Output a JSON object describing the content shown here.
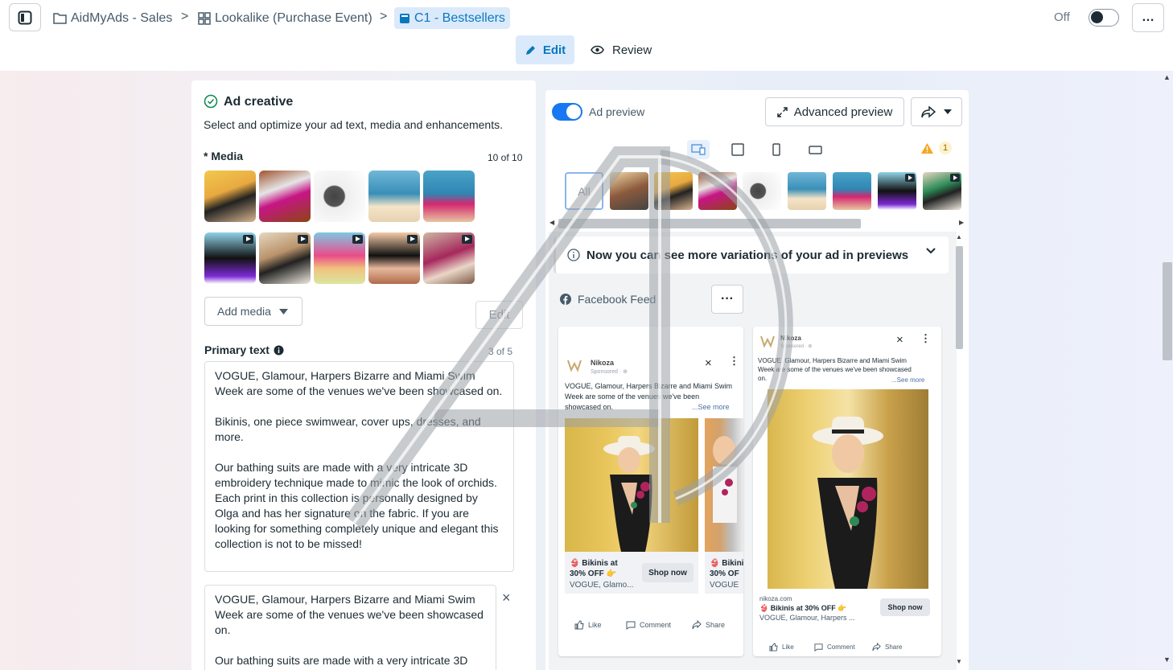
{
  "breadcrumb": {
    "account": "AidMyAds - Sales",
    "adset": "Lookalike (Purchase Event)",
    "ad": "C1 - Bestsellers"
  },
  "header": {
    "toggle_label": "Off",
    "more_label": "…"
  },
  "modes": {
    "edit": "Edit",
    "review": "Review"
  },
  "ad_creative": {
    "title": "Ad creative",
    "subtitle": "Select and optimize your ad text, media and enhancements.",
    "media_label": "* Media",
    "media_count": "10 of 10",
    "add_media": "Add media",
    "edit": "Edit",
    "primary_text_label": "Primary text",
    "primary_text_count": "3 of 5",
    "primary_text_1": "VOGUE, Glamour, Harpers Bizarre and Miami Swim Week are some of the venues we've been showcased on.\n\nBikinis, one piece swimwear, cover ups, dresses, and more.\n\nOur bathing suits are made with a very intricate 3D embroidery technique made to mimic the look of orchids. Each print in this collection is personally designed by Olga and has her signature on the fabric. If you are looking for something completely unique and elegant this collection is not to be missed!",
    "primary_text_2": "VOGUE, Glamour, Harpers Bizarre and Miami Swim Week are some of the venues we've been showcased on.\n\nOur bathing suits are made with a very intricate 3D",
    "close_label": "×"
  },
  "preview": {
    "toggle_label": "Ad preview",
    "advanced_preview": "Advanced preview",
    "warning_count": "1",
    "all_label": "All",
    "banner": "Now you can see more variations of your ad in previews",
    "placement": "Facebook Feed",
    "dots": "···"
  },
  "fb_card_1": {
    "page": "Nikoza",
    "sponsored": "Sponsored · ⊕",
    "text": "VOGUE, Glamour, Harpers Bizarre and Miami Swim Week are some of the venues we've been showcased on.",
    "see_more": "...See more",
    "cta_title": "👙 Bikinis at 30% OFF 👉",
    "cta_sub": "VOGUE, Glamo...",
    "shop": "Shop now",
    "cta_title_b": "👙 Bikini 30% OF",
    "cta_sub_b": "VOGUE",
    "like": "Like",
    "comment": "Comment",
    "share": "Share"
  },
  "fb_card_2": {
    "page": "Nikoza",
    "sponsored": "Sponsored · ⊕",
    "text": "VOGUE, Glamour, Harpers Bizarre and Miami Swim Week are some of the venues we've been showcased on.",
    "see_more": "...See more",
    "domain": "nikoza.com",
    "cta_title": "👙 Bikinis at 30% OFF 👉",
    "cta_sub": "VOGUE, Glamour, Harpers ...",
    "shop": "Shop now",
    "like": "Like",
    "comment": "Comment",
    "share": "Share"
  },
  "colors": {
    "accent": "#0a78be",
    "primary_blue": "#1877f2",
    "warning": "#f5a623"
  },
  "icons": {
    "sidebar": "sidebar-toggle-icon",
    "folder": "folder-icon",
    "grid": "grid-icon",
    "ad": "ad-icon",
    "pencil": "pencil-icon",
    "eye": "eye-icon",
    "check": "check-circle-icon",
    "info": "info-icon",
    "expand": "expand-icon",
    "share": "share-icon",
    "warning": "warning-icon"
  }
}
